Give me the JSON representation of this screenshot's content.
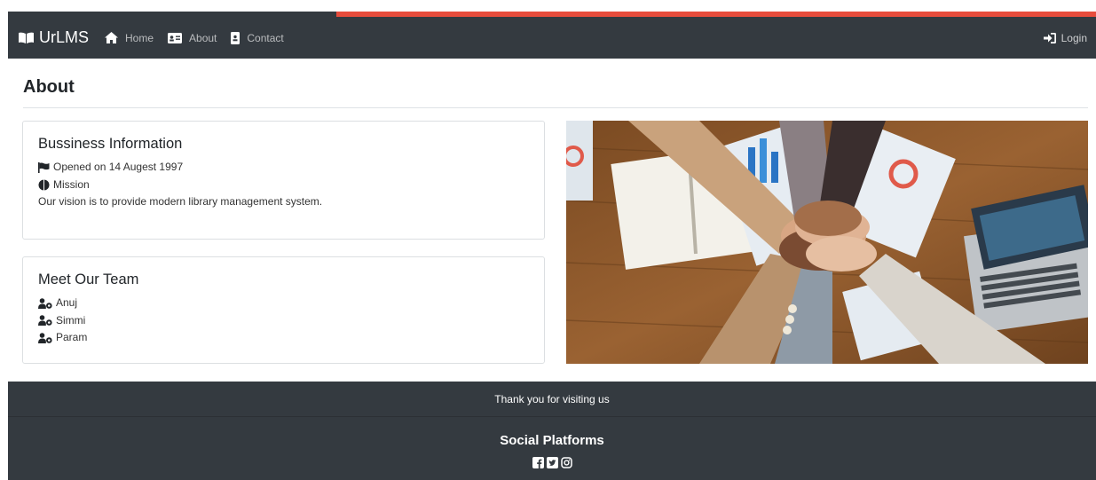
{
  "nav": {
    "brand": "UrLMS",
    "items": [
      {
        "label": "Home",
        "icon": "home-icon"
      },
      {
        "label": "About",
        "icon": "id-card-icon"
      },
      {
        "label": "Contact",
        "icon": "contact-card-icon"
      }
    ],
    "login": "Login",
    "colors": {
      "bar": "#343a40",
      "progress": "#e74c3c"
    }
  },
  "page": {
    "title": "About"
  },
  "business": {
    "title": "Bussiness Information",
    "opened": "Opened on 14 Augest 1997",
    "mission_label": "Mission",
    "vision": "Our vision is to provide modern library management system."
  },
  "team": {
    "title": "Meet Our Team",
    "members": [
      "Anuj",
      "Simmi",
      "Param"
    ]
  },
  "footer": {
    "thanks": "Thank you for visiting us",
    "social_title": "Social Platforms",
    "social_icons": [
      "facebook-icon",
      "twitter-icon",
      "instagram-icon"
    ]
  }
}
